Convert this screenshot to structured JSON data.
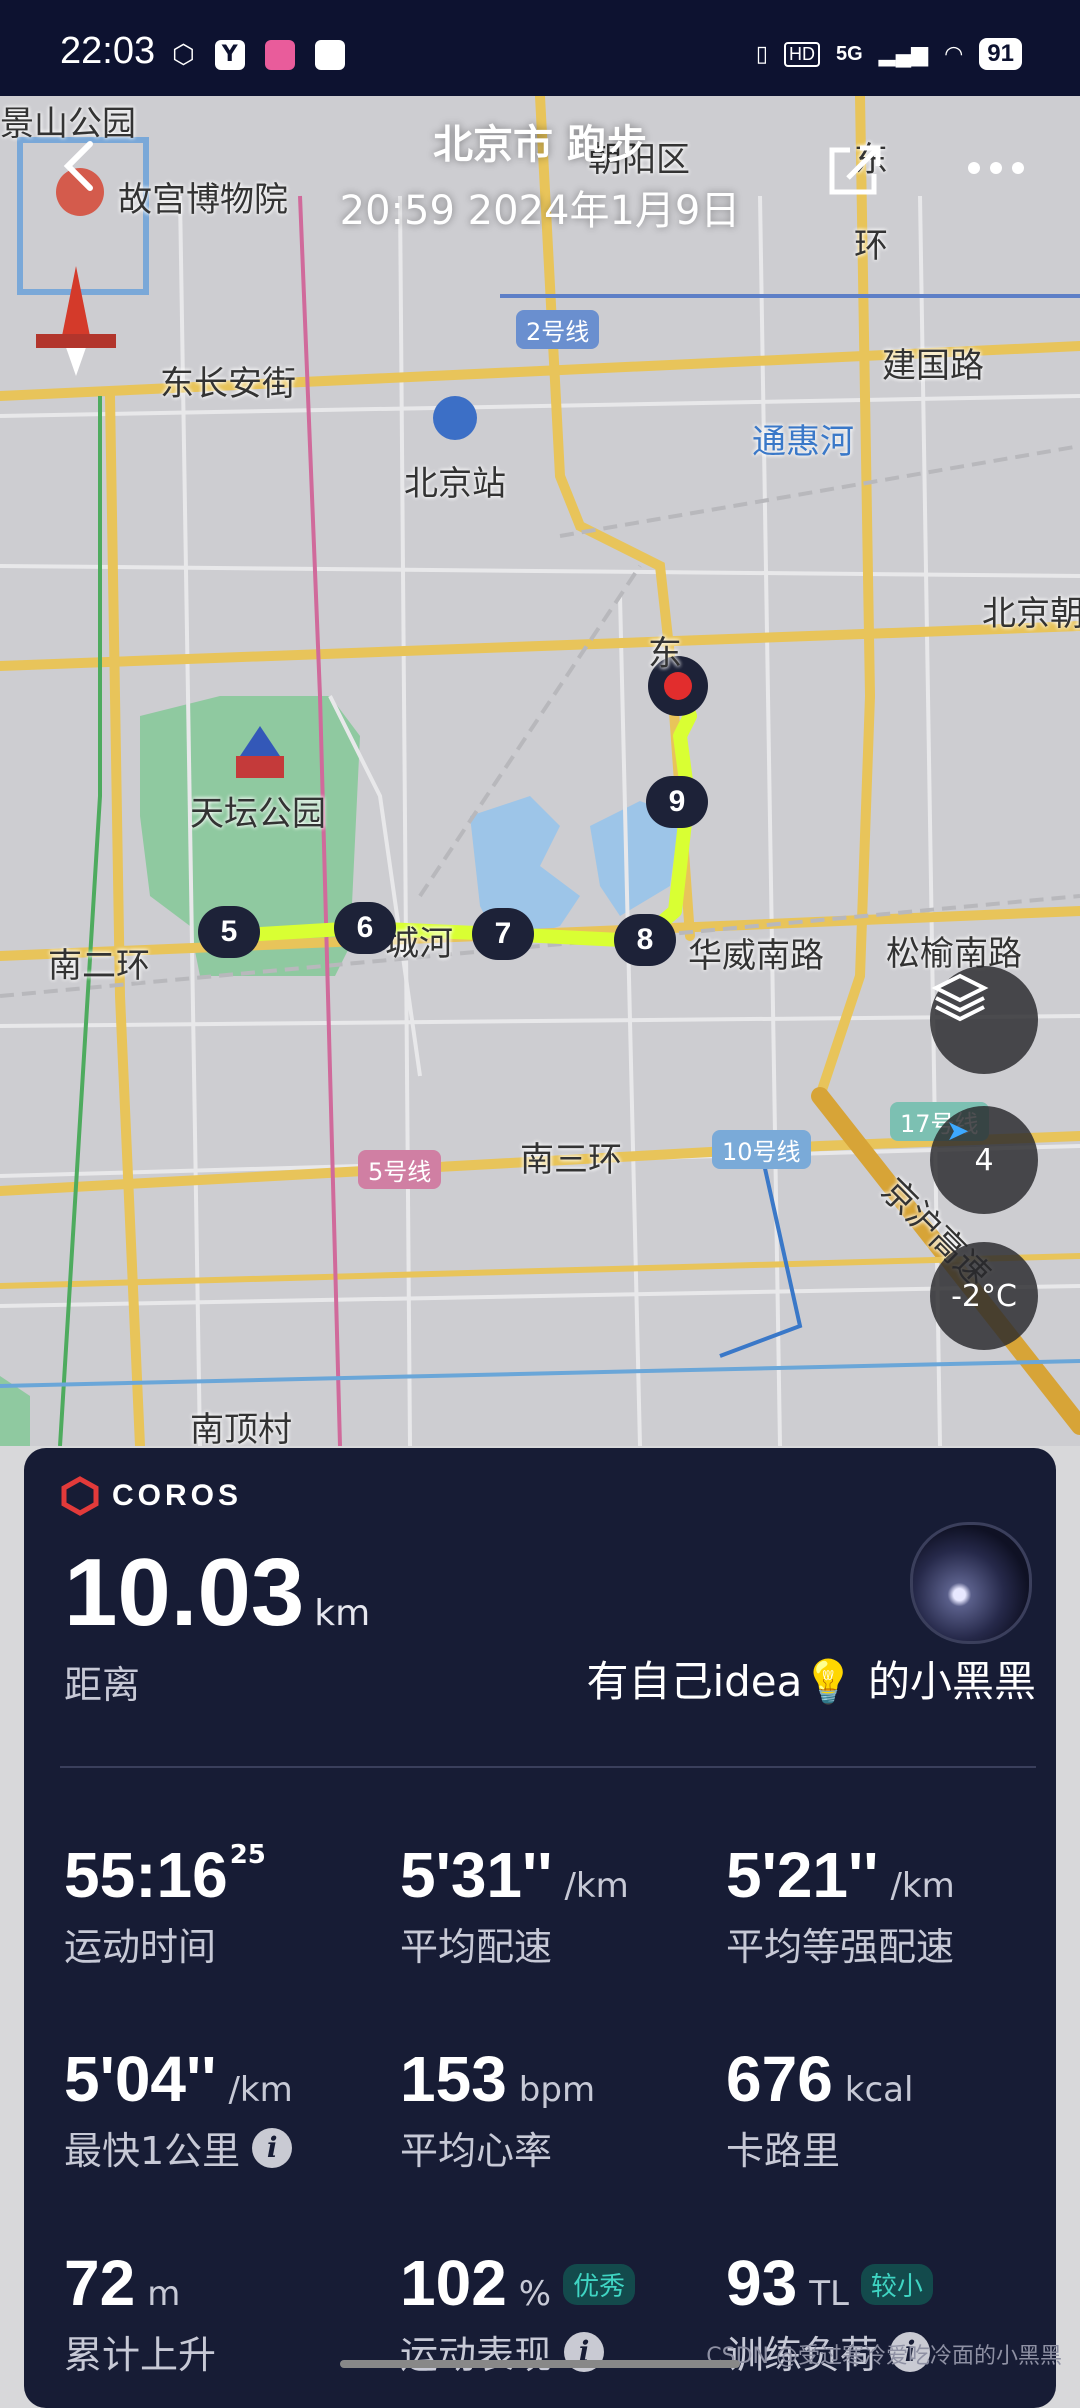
{
  "status_bar": {
    "time": "22:03",
    "network": "5G",
    "hd": "HD",
    "battery": "91"
  },
  "header": {
    "title": "北京市 跑步",
    "subtitle": "20:59 2024年1月9日"
  },
  "map": {
    "labels": {
      "jingshan": "景山公园",
      "gugong": "故宫博物院",
      "chaoyang": "朝阳区",
      "dong": "东",
      "huan": "环",
      "dongchangan": "东长安街",
      "jianguo": "建国路",
      "tonghuihe": "通惠河",
      "beijingzhan": "北京站",
      "beijingchao": "北京朝",
      "tiantan": "天坛公园",
      "dong2": "东",
      "huan2": "环",
      "nanerhuan": "南二环",
      "huawei": "华威南路",
      "songyu": "松榆南路",
      "nansanhuan": "南三环",
      "jinghu": "京沪高速",
      "nandingcun": "南顶村",
      "nan": "南",
      "chengxian": "城河"
    },
    "lines": {
      "line2": "2号线",
      "line5": "5号线",
      "line10": "10号线",
      "line17": "17号线"
    },
    "markers": [
      "5",
      "6",
      "7",
      "8",
      "9"
    ],
    "compass_value": "4",
    "temperature": "-2°C"
  },
  "card": {
    "brand": "COROS",
    "distance": {
      "value": "10.03",
      "unit": "km",
      "label": "距离"
    },
    "user": "有自己idea💡 的小黑黑",
    "stats": [
      {
        "value": "55:16",
        "sup": "25",
        "unit": "",
        "label": "运动时间"
      },
      {
        "value": "5'31''",
        "unit": "/km",
        "label": "平均配速"
      },
      {
        "value": "5'21''",
        "unit": "/km",
        "label": "平均等强配速"
      },
      {
        "value": "5'04''",
        "unit": "/km",
        "label": "最快1公里"
      },
      {
        "value": "153",
        "unit": "bpm",
        "label": "平均心率"
      },
      {
        "value": "676",
        "unit": "kcal",
        "label": "卡路里"
      },
      {
        "value": "72",
        "unit": "m",
        "label": "累计上升"
      },
      {
        "value": "102",
        "unit": "%",
        "label": "运动表现",
        "badge": "优秀"
      },
      {
        "value": "93",
        "unit": "TL",
        "label": "训练负荷",
        "badge": "较小"
      }
    ]
  },
  "watermark": "CSDN @受过寒冷爱吃冷面的小黑黑"
}
